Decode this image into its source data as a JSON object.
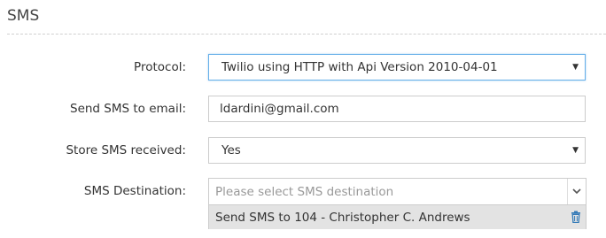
{
  "section": {
    "title": "SMS"
  },
  "protocol": {
    "label": "Protocol:",
    "value": "Twilio using HTTP with Api Version 2010-04-01"
  },
  "email": {
    "label": "Send SMS to email:",
    "value": "ldardini@gmail.com"
  },
  "store": {
    "label": "Store SMS received:",
    "value": "Yes"
  },
  "destination": {
    "label": "SMS Destination:",
    "placeholder": "Please select SMS destination",
    "selected": [
      "Send SMS to 104 - Christopher C. Andrews"
    ]
  },
  "icons": {
    "caret": "caret-down-icon",
    "chevron": "chevron-down-icon",
    "remove": "trash-icon"
  },
  "colors": {
    "focus_border": "#66afe9",
    "selected_item_bg": "#e3e3e3",
    "trash_icon": "#337ab7"
  }
}
